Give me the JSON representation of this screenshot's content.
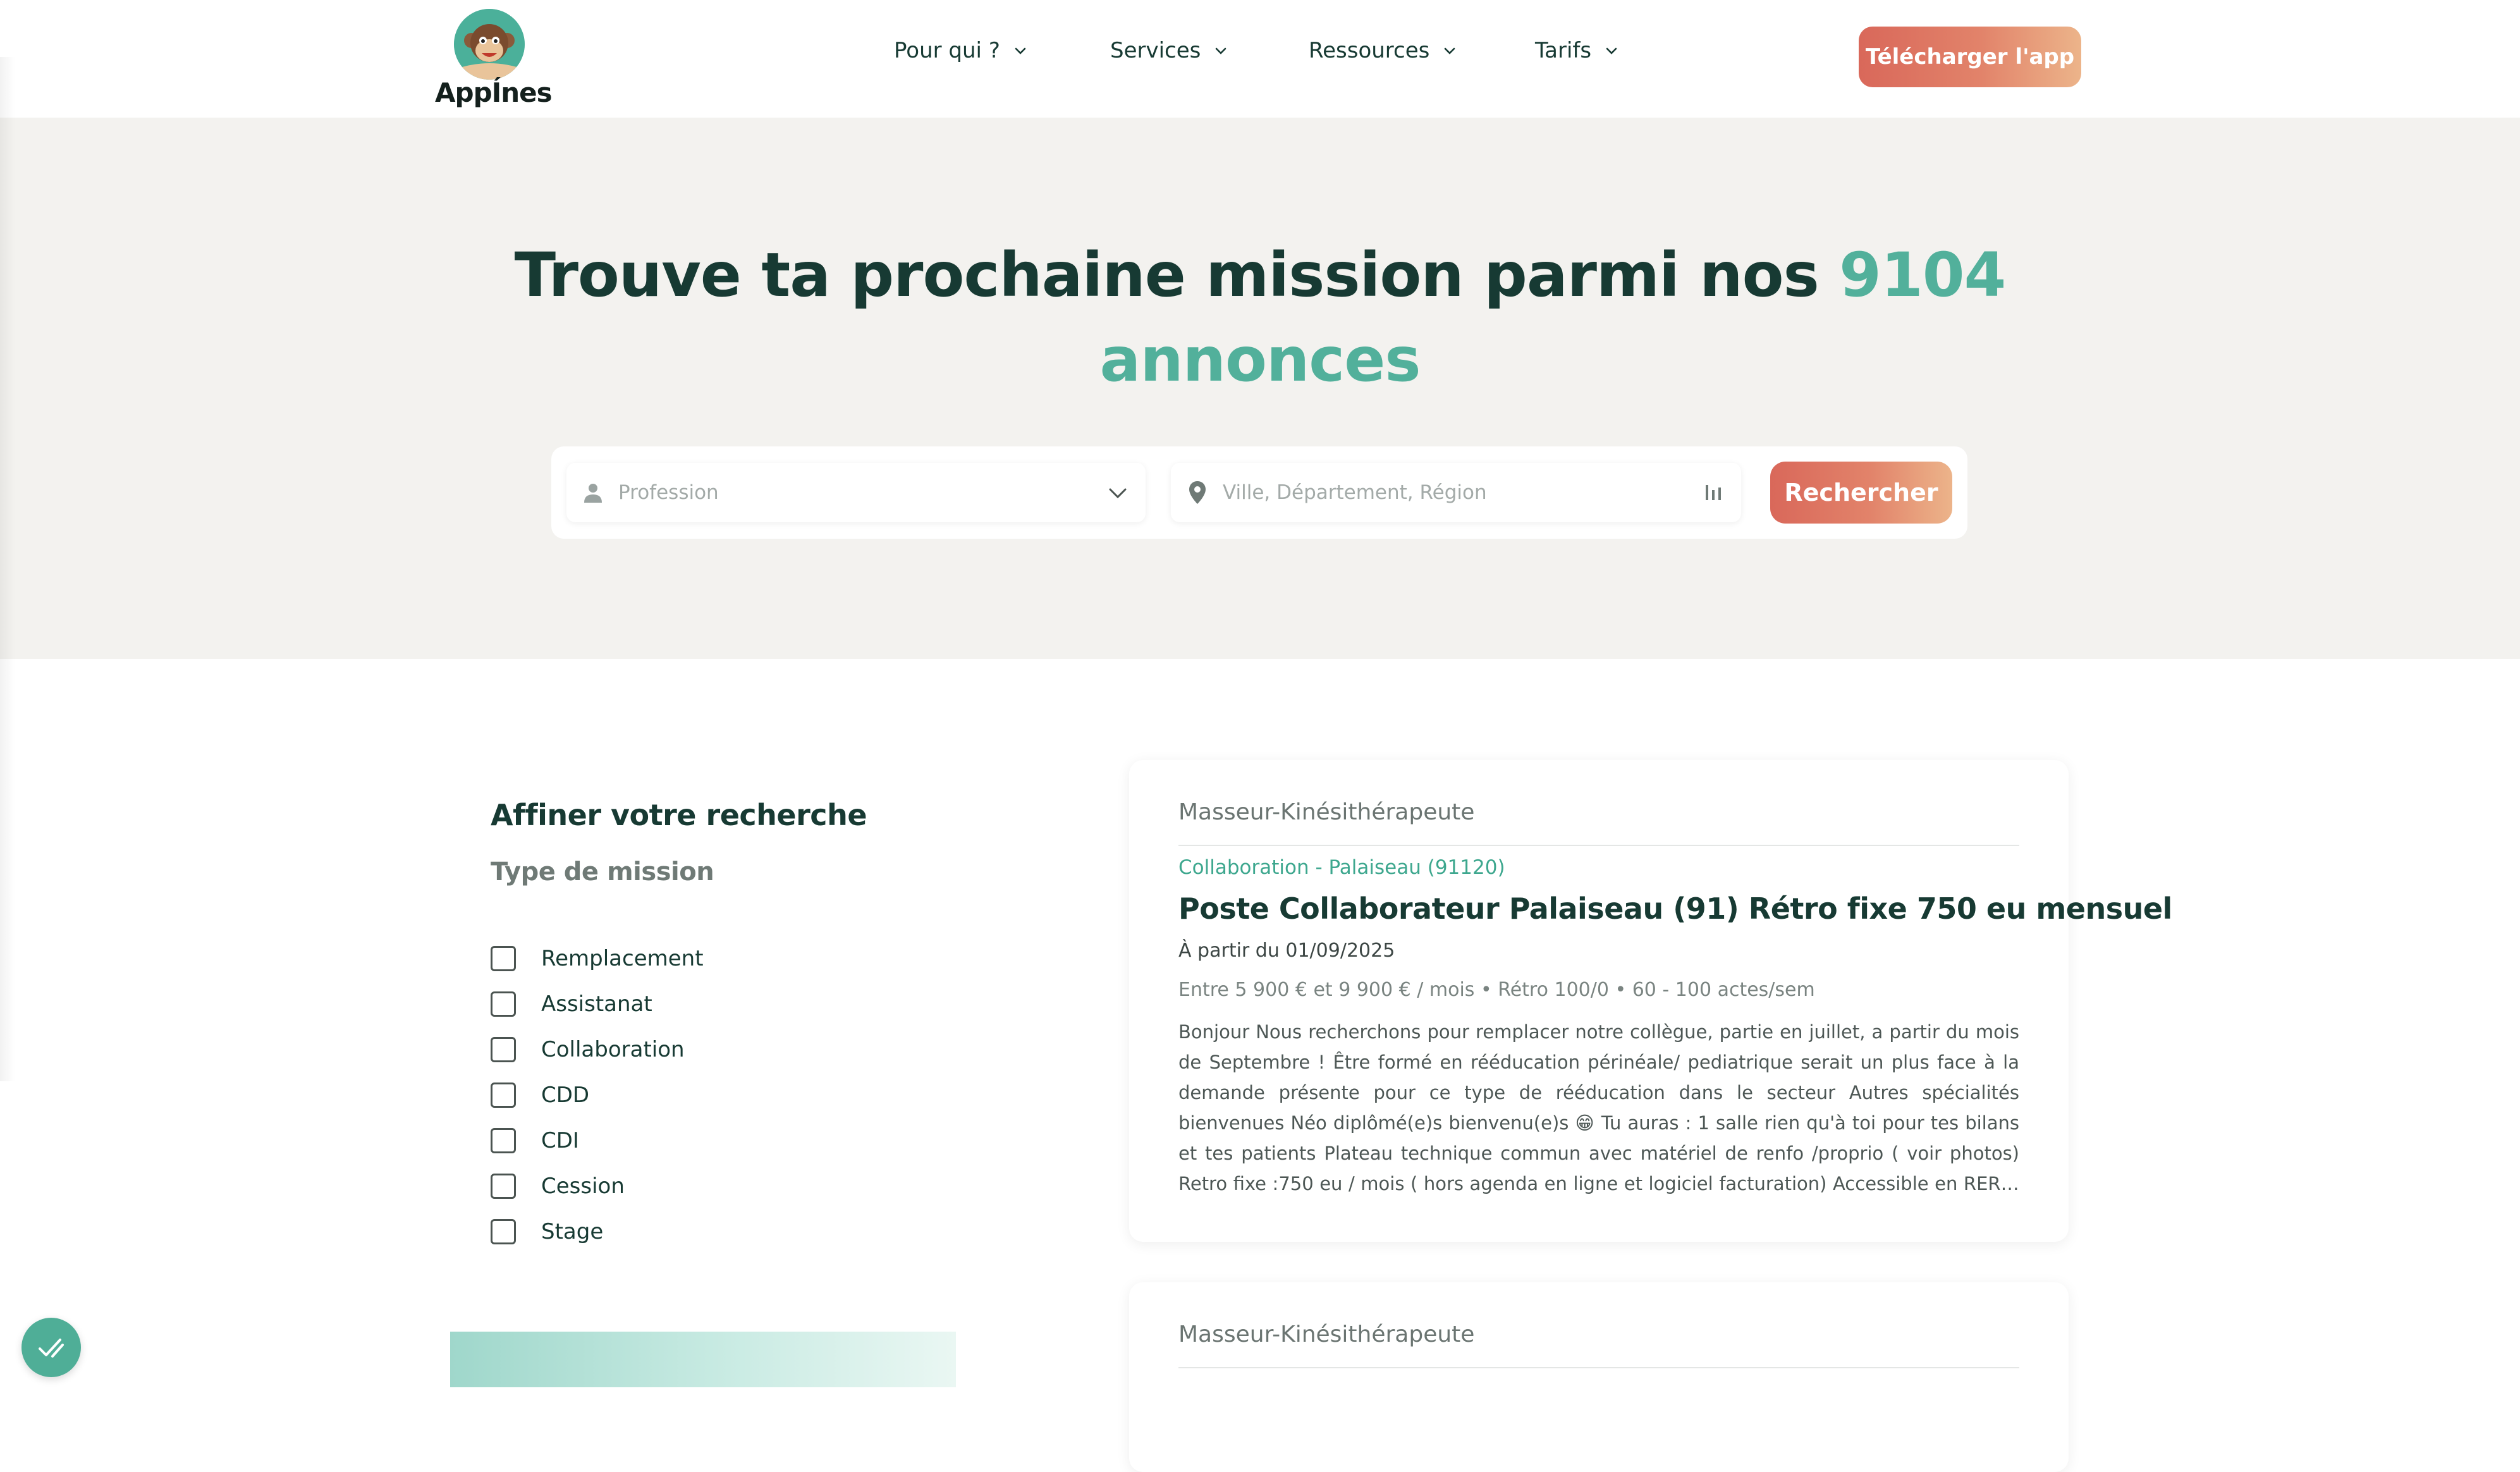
{
  "brand": {
    "name": "AppÍnes"
  },
  "nav": {
    "items": [
      {
        "label": "Pour qui ?"
      },
      {
        "label": "Services"
      },
      {
        "label": "Ressources"
      },
      {
        "label": "Tarifs"
      }
    ],
    "cta_label": "Télécharger l'app"
  },
  "hero": {
    "title_part1": "Trouve ta prochaine mission parmi nos",
    "count": "9104",
    "title_part2": "annonces"
  },
  "search": {
    "profession_placeholder": "Profession",
    "location_placeholder": "Ville, Département, Région",
    "button_label": "Rechercher"
  },
  "filters": {
    "title": "Affiner votre recherche",
    "mission_type_label": "Type de mission",
    "options": [
      {
        "label": "Remplacement",
        "checked": false
      },
      {
        "label": "Assistanat",
        "checked": false
      },
      {
        "label": "Collaboration",
        "checked": false
      },
      {
        "label": "CDD",
        "checked": false
      },
      {
        "label": "CDI",
        "checked": false
      },
      {
        "label": "Cession",
        "checked": false
      },
      {
        "label": "Stage",
        "checked": false
      }
    ]
  },
  "listings": [
    {
      "profession": "Masseur-Kinésithérapeute",
      "meta": "Collaboration - Palaiseau (91120)",
      "title": "Poste Collaborateur Palaiseau (91) Rétro fixe 750 eu mensuel",
      "start": "À partir du 01/09/2025",
      "pay": "Entre 5 900 € et 9 900 € / mois • Rétro 100/0 • 60 - 100 actes/sem",
      "description": "Bonjour Nous recherchons pour remplacer notre collègue, partie en juillet, a partir du mois de Septembre ! Être formé en rééducation périnéale/ pediatrique serait un plus face à la demande présente pour ce type de rééducation dans le secteur Autres spécialités bienvenues Néo diplômé(e)s bienvenu(e)s 😁 Tu auras : 1 salle rien qu'à toi pour tes bilans et tes patients Plateau technique commun avec matériel de renfo /proprio ( voir photos) Retro fixe :750 eu / mois ( hors agenda en ligne et logiciel facturation) Accessible en RER B Parking facile po..."
    },
    {
      "profession": "Masseur-Kinésithérapeute"
    }
  ],
  "colors": {
    "primary_dark": "#173a33",
    "accent_green": "#52b09b",
    "cta_gradient_start": "#d9685a",
    "cta_gradient_end": "#ecb48a",
    "hero_bg": "#f3f2ef"
  },
  "icons": {
    "nav_dropdown": "chevron-down-icon",
    "profession_field": "user-icon",
    "profession_dropdown": "chevron-down-icon",
    "location_field": "map-pin-icon",
    "location_tail": "geolocate-icon",
    "fab": "check-icon"
  }
}
